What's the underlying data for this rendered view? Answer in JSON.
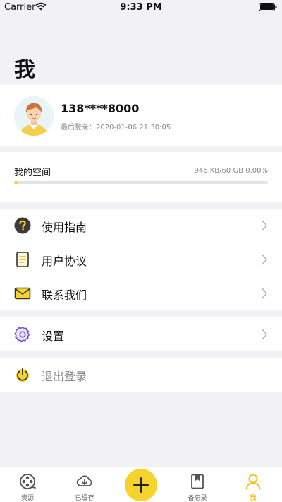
{
  "status_bar": {
    "carrier": "Carrier",
    "time": "9:33 PM"
  },
  "page": {
    "title": "我"
  },
  "profile": {
    "phone": "138****8000",
    "last_login": "最后登录：2020-01-06 21:30:05"
  },
  "storage": {
    "label": "我的空间",
    "usage": "946 KB/60 GB  0.00%",
    "used_fraction": 0.0
  },
  "menu": {
    "guide": "使用指南",
    "agreement": "用户协议",
    "contact": "联系我们",
    "settings": "设置",
    "logout": "退出登录"
  },
  "tabs": [
    {
      "label": "资源",
      "icon": "film-reel-icon"
    },
    {
      "label": "已缓存",
      "icon": "cloud-download-icon"
    },
    {
      "label": "备忘录",
      "icon": "bookmark-book-icon"
    },
    {
      "label": "我",
      "icon": "user-icon",
      "active": true
    }
  ],
  "colors": {
    "accent": "#f7d42d",
    "accent_text": "#f1c21b",
    "background": "#f2f2f6"
  }
}
